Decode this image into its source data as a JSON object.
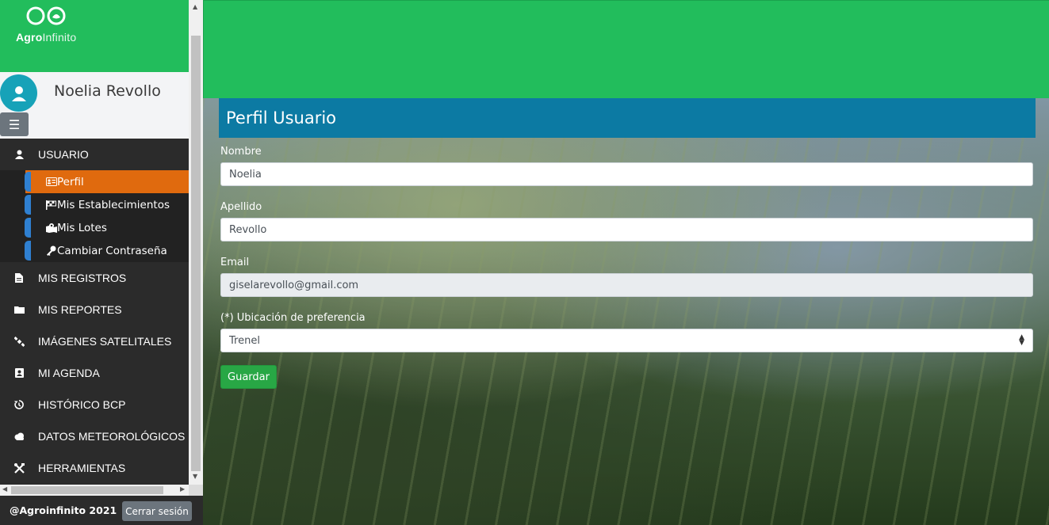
{
  "brand": {
    "logo_bold": "Agro",
    "logo_light": "Infinito"
  },
  "user": {
    "name": "Noelia Revollo"
  },
  "nav": {
    "usuario": "USUARIO",
    "sub": [
      {
        "label": "Perfil",
        "icon": "id-card-icon",
        "active": true
      },
      {
        "label": "Mis Establecimientos",
        "icon": "flag-checkered-icon"
      },
      {
        "label": "Mis Lotes",
        "icon": "map-marked-icon"
      },
      {
        "label": "Cambiar Contraseña",
        "icon": "key-icon"
      }
    ],
    "items": [
      {
        "label": "MIS REGISTROS",
        "icon": "file-icon"
      },
      {
        "label": "MIS REPORTES",
        "icon": "folder-icon"
      },
      {
        "label": "IMÁGENES SATELITALES",
        "icon": "satellite-icon"
      },
      {
        "label": "MI AGENDA",
        "icon": "address-book-icon"
      },
      {
        "label": "HISTÓRICO BCP",
        "icon": "history-icon"
      },
      {
        "label": "DATOS METEOROLÓGICOS",
        "icon": "cloud-icon"
      },
      {
        "label": "HERRAMIENTAS",
        "icon": "tools-icon"
      }
    ]
  },
  "footer": {
    "copyright": "@Agroinfinito 2021",
    "logout": "Cerrar sesión"
  },
  "page": {
    "title": "Perfil Usuario"
  },
  "form": {
    "nombre_label": "Nombre",
    "nombre_value": "Noelia",
    "apellido_label": "Apellido",
    "apellido_value": "Revollo",
    "email_label": "Email",
    "email_value": "giselarevollo@gmail.com",
    "ubicacion_label": "(*) Ubicación de preferencia",
    "ubicacion_value": "Trenel",
    "save_label": "Guardar"
  },
  "colors": {
    "brand_green": "#22bd5c",
    "title_blue": "#0c7aa3",
    "active_orange": "#e06a0e",
    "save_green": "#28a745"
  }
}
